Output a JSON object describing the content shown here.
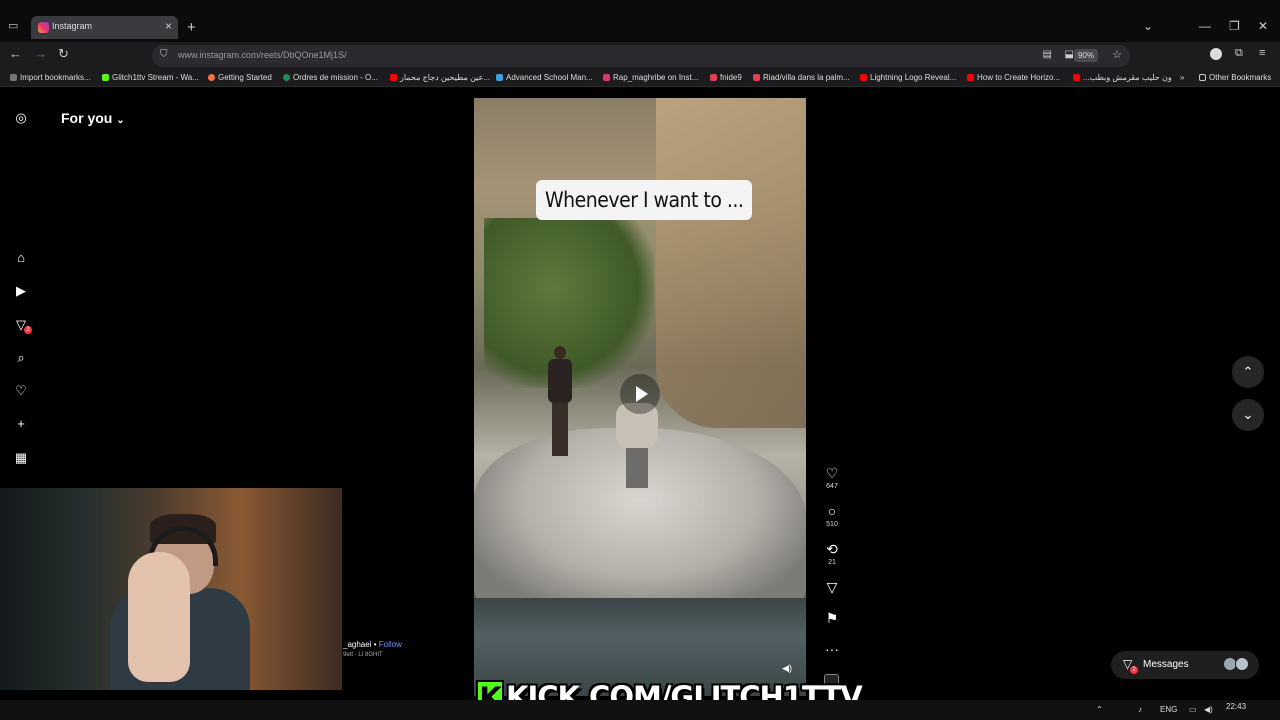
{
  "browser": {
    "tab_title": "Instagram",
    "url_domain": "www.instagram.com",
    "url_path": "/reels/DbQOne1Mj1S/",
    "zoom": "90%",
    "bookmarks": [
      "Import bookmarks...",
      "Glitch1ttv Stream - Wa...",
      "Getting Started",
      "Ordres de mission - O...",
      "عين مطيحين دجاج محمار...",
      "Advanced School Man...",
      "Rap_maghribe on Inst...",
      "fnide9",
      "Riad/villa dans la palm...",
      "Lightning Logo Reveal...",
      "How to Create Horizo...",
      "...ون حليب مقرمش وبطب",
      "Other Bookmarks"
    ]
  },
  "sidebar": {
    "feed_title": "For you",
    "notifications_badge": "2"
  },
  "reel": {
    "caption": "Whenever I want to ...",
    "likes": "647",
    "comments": "510",
    "reposts": "21",
    "username": "_aghaei",
    "follow_label": "Follow",
    "audio": "9ett · LI 8GHIT"
  },
  "messages": {
    "label": "Messages",
    "badge": "2"
  },
  "overlay": {
    "kick_text": "KICK.COM/GLITCH1TTV"
  },
  "taskbar": {
    "lang": "ENG",
    "time": "22:43"
  }
}
